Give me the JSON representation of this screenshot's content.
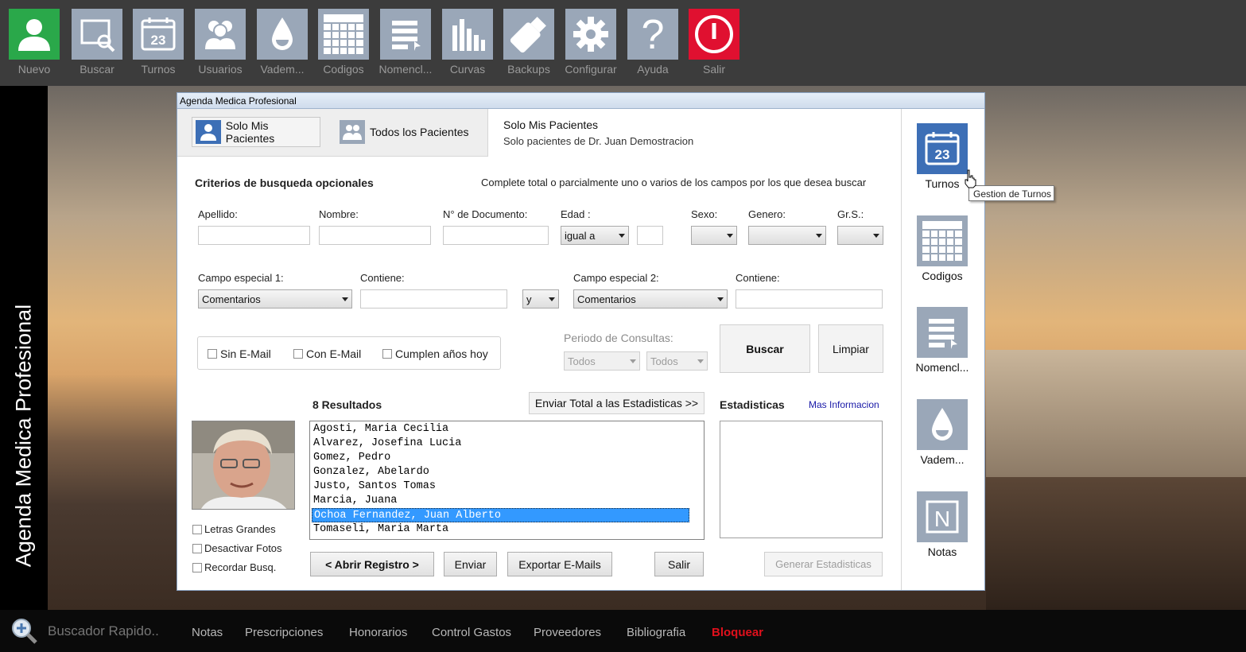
{
  "toolbar": {
    "items": [
      {
        "label": "Nuevo",
        "icon": "new-patient-icon"
      },
      {
        "label": "Buscar",
        "icon": "search-icon"
      },
      {
        "label": "Turnos",
        "icon": "calendar-icon"
      },
      {
        "label": "Usuarios",
        "icon": "users-icon"
      },
      {
        "label": "Vadem...",
        "icon": "drop-icon"
      },
      {
        "label": "Codigos",
        "icon": "grid-icon"
      },
      {
        "label": "Nomencl...",
        "icon": "list-icon"
      },
      {
        "label": "Curvas",
        "icon": "bars-icon"
      },
      {
        "label": "Backups",
        "icon": "usb-icon"
      },
      {
        "label": "Configurar",
        "icon": "gear-icon"
      },
      {
        "label": "Ayuda",
        "icon": "question-icon"
      },
      {
        "label": "Salir",
        "icon": "power-icon"
      }
    ],
    "calendar_day": "23",
    "colors": {
      "nuevo": "#2aa84a",
      "salir": "#e01030",
      "default": "#9aa7b8"
    }
  },
  "sidebar": {
    "vertical_title": "Agenda Medica Profesional"
  },
  "dialog": {
    "title": "Agenda Medica Profesional",
    "tabs": {
      "mine": "Solo Mis Pacientes",
      "all": "Todos los Pacientes"
    },
    "header_info": {
      "title": "Solo Mis Pacientes",
      "subtitle": "Solo pacientes de Dr. Juan Demostracion"
    },
    "criteria": {
      "title": "Criterios de busqueda opcionales",
      "hint": "Complete total o parcialmente uno o varios de los campos por los que desea buscar"
    },
    "fields": {
      "apellido": "Apellido:",
      "nombre": "Nombre:",
      "documento": "N° de Documento:",
      "edad": "Edad :",
      "edad_op": "igual a",
      "sexo": "Sexo:",
      "genero": "Genero:",
      "grs": "Gr.S.:",
      "campo1": "Campo especial 1:",
      "campo1_value": "Comentarios",
      "contiene1": "Contiene:",
      "conj": "y",
      "campo2": "Campo especial 2:",
      "campo2_value": "Comentarios",
      "contiene2": "Contiene:"
    },
    "checks": {
      "sin_email": "Sin E-Mail",
      "con_email": "Con E-Mail",
      "cumplen": "Cumplen años hoy"
    },
    "periodo": {
      "label": "Periodo de Consultas:",
      "from": "Todos",
      "to": "Todos"
    },
    "buttons": {
      "buscar": "Buscar",
      "limpiar": "Limpiar",
      "enviar_total": "Enviar Total a las Estadisticas >>",
      "abrir": "< Abrir Registro >",
      "enviar": "Enviar",
      "exportar": "Exportar E-Mails",
      "salir": "Salir",
      "generar": "Generar Estadisticas"
    },
    "results": {
      "count_label": "8 Resultados",
      "items": [
        "Agosti, Maria Cecilia",
        "Alvarez, Josefina Lucia",
        "Gomez, Pedro",
        "Gonzalez, Abelardo",
        "Justo, Santos Tomas",
        "Marcia, Juana",
        "Ochoa Fernandez, Juan Alberto",
        "Tomaseli, Maria Marta"
      ],
      "selected_index": 6
    },
    "stats": {
      "title": "Estadisticas",
      "more": "Mas Informacion"
    },
    "options": {
      "letras": "Letras Grandes",
      "fotos": "Desactivar Fotos",
      "recordar": "Recordar Busq."
    }
  },
  "right_panel": {
    "items": [
      {
        "label": "Turnos",
        "icon": "calendar-icon"
      },
      {
        "label": "Codigos",
        "icon": "grid-icon"
      },
      {
        "label": "Nomencl...",
        "icon": "list-icon"
      },
      {
        "label": "Vadem...",
        "icon": "drop-icon"
      },
      {
        "label": "Notas",
        "icon": "notes-icon"
      }
    ],
    "calendar_day": "23",
    "notes_letter": "N"
  },
  "tooltip": "Gestion de Turnos",
  "bottombar": {
    "search_placeholder": "Buscador Rapido..",
    "links": [
      "Notas",
      "Prescripciones",
      "Honorarios",
      "Control Gastos",
      "Proveedores",
      "Bibliografia",
      "Bloquear"
    ]
  }
}
